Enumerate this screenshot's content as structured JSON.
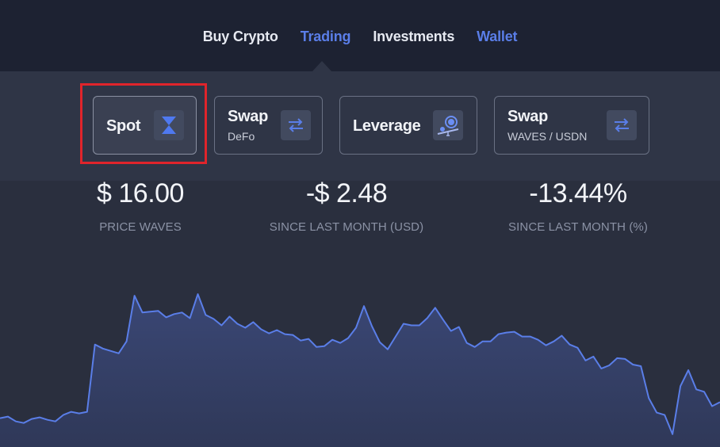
{
  "nav": {
    "items": [
      {
        "label": "Buy Crypto",
        "state": "default"
      },
      {
        "label": "Trading",
        "state": "active"
      },
      {
        "label": "Investments",
        "state": "default"
      },
      {
        "label": "Wallet",
        "state": "accent"
      }
    ]
  },
  "cards": [
    {
      "title": "Spot",
      "subtitle": "",
      "icon": "hourglass-icon",
      "selected": true
    },
    {
      "title": "Swap",
      "subtitle": "DeFo",
      "icon": "swap-arrows-icon",
      "selected": false
    },
    {
      "title": "Leverage",
      "subtitle": "",
      "icon": "leverage-icon",
      "selected": false
    },
    {
      "title": "Swap",
      "subtitle": "WAVES / USDN",
      "icon": "swap-arrows-icon",
      "selected": false
    }
  ],
  "stats": [
    {
      "value": "$ 16.00",
      "label": "PRICE WAVES"
    },
    {
      "value": "-$ 2.48",
      "label": "SINCE LAST MONTH (USD)"
    },
    {
      "value": "-13.44%",
      "label": "SINCE LAST MONTH (%)"
    }
  ],
  "colors": {
    "accent": "#5a7ee8",
    "line": "#5a7ee8",
    "highlight_box": "#e0242b"
  },
  "chart_data": {
    "type": "area",
    "title": "",
    "xlabel": "",
    "ylabel": "",
    "grid": false,
    "series": [
      {
        "values": [
          3.6,
          3.8,
          3.2,
          3.0,
          3.5,
          3.7,
          3.4,
          3.2,
          4.0,
          4.4,
          4.2,
          4.4,
          12.8,
          12.3,
          12.0,
          11.7,
          13.2,
          18.9,
          16.8,
          16.9,
          17.0,
          16.2,
          16.6,
          16.8,
          16.1,
          19.1,
          16.5,
          16.0,
          15.2,
          16.3,
          15.4,
          14.9,
          15.6,
          14.7,
          14.2,
          14.6,
          14.1,
          14.0,
          13.3,
          13.5,
          12.5,
          12.6,
          13.4,
          13.0,
          13.6,
          14.9,
          17.6,
          15.1,
          13.1,
          12.2,
          13.8,
          15.4,
          15.2,
          15.2,
          16.1,
          17.4,
          15.9,
          14.5,
          15.0,
          13.0,
          12.5,
          13.2,
          13.2,
          14.1,
          14.3,
          14.4,
          13.8,
          13.8,
          13.4,
          12.7,
          13.2,
          13.9,
          12.8,
          12.4,
          10.8,
          11.3,
          9.8,
          10.2,
          11.1,
          11.0,
          10.3,
          10.1,
          6.1,
          4.3,
          4.0,
          1.6,
          7.6,
          9.6,
          7.2,
          6.9,
          5.1,
          5.6
        ]
      }
    ]
  }
}
